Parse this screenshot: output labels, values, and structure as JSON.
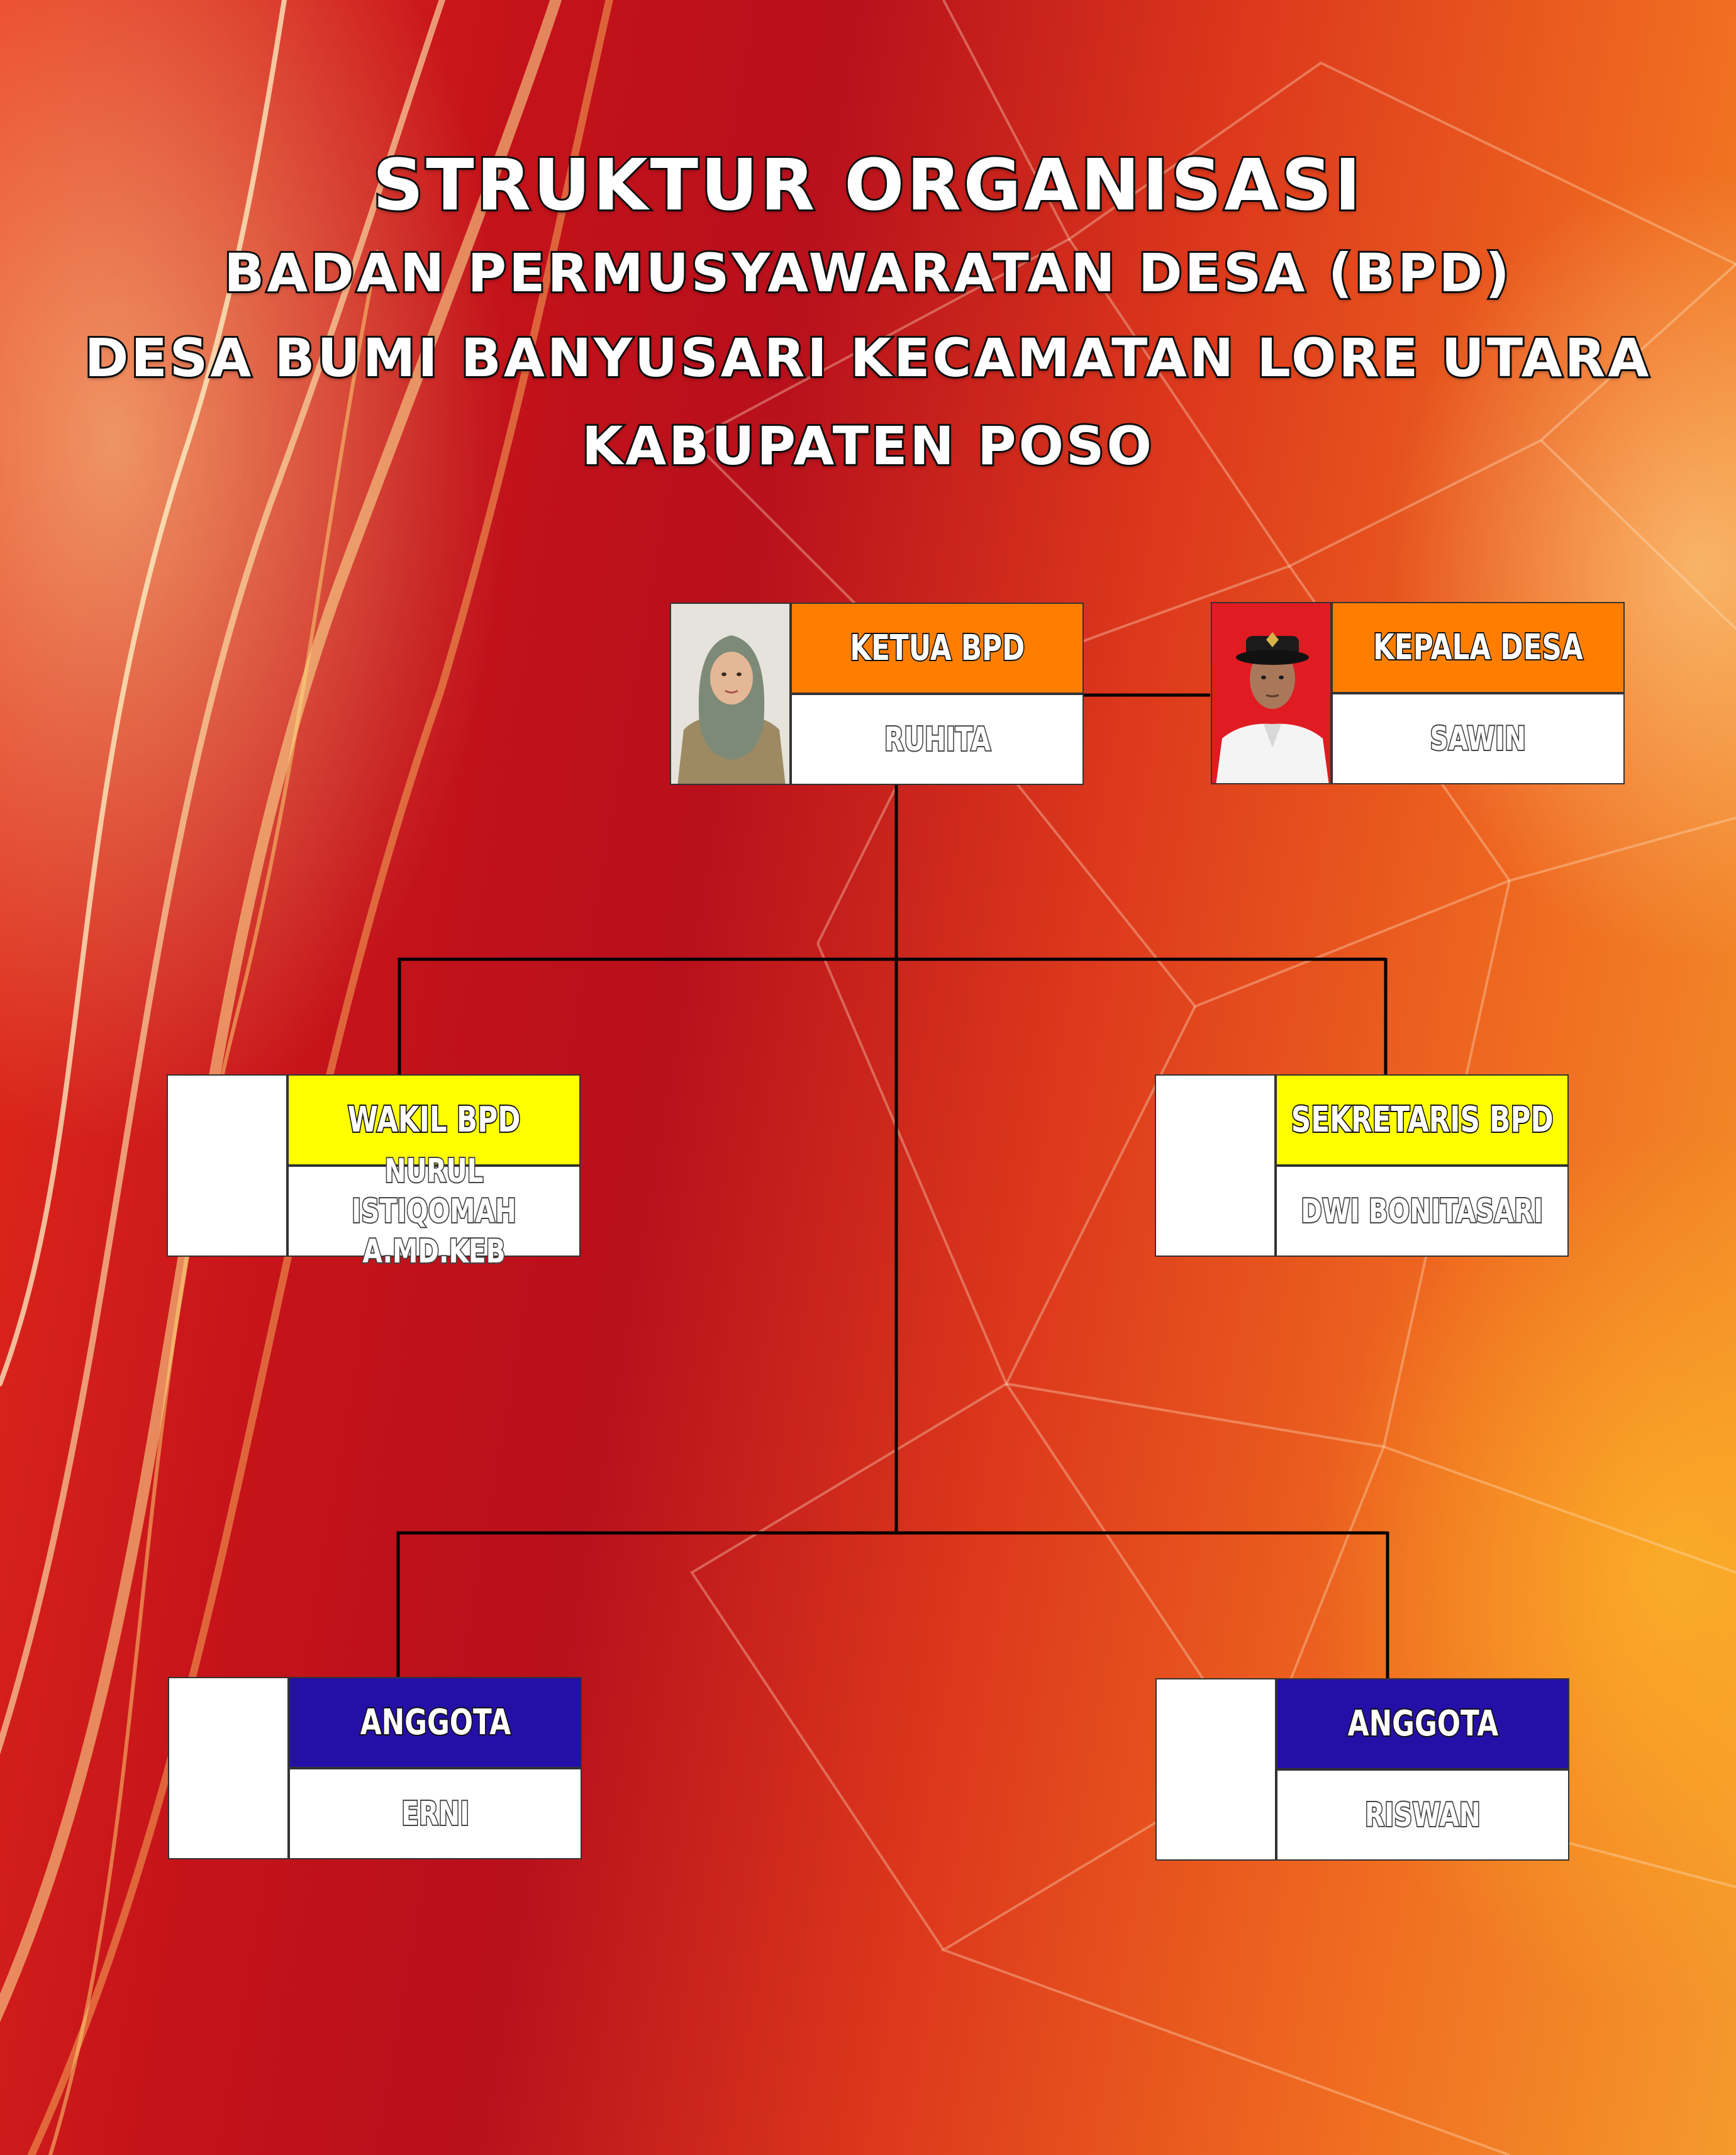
{
  "title": {
    "line1": "STRUKTUR ORGANISASI",
    "line2": "BADAN PERMUSYAWARATAN DESA (BPD)",
    "line3": "DESA BUMI BANYUSARI KECAMATAN LORE UTARA",
    "line4": "KABUPATEN POSO"
  },
  "cards": {
    "ketua": {
      "role": "KETUA BPD",
      "name": "RUHITA",
      "photo_icon": "woman-hijab-portrait-icon"
    },
    "kepala": {
      "role": "KEPALA DESA",
      "name": "SAWIN",
      "photo_icon": "man-uniform-portrait-icon"
    },
    "wakil": {
      "role": "WAKIL BPD",
      "name": "NURUL ISTIQOMAH A.MD.KEB"
    },
    "sekretaris": {
      "role": "SEKRETARIS BPD",
      "name": "DWI BONITASARI"
    },
    "anggota1": {
      "role": "ANGGOTA",
      "name": "ERNI"
    },
    "anggota2": {
      "role": "ANGGOTA",
      "name": "RISWAN"
    }
  },
  "colors": {
    "orange": "#ff7e00",
    "yellow": "#ffff00",
    "blue": "#2410a6"
  }
}
